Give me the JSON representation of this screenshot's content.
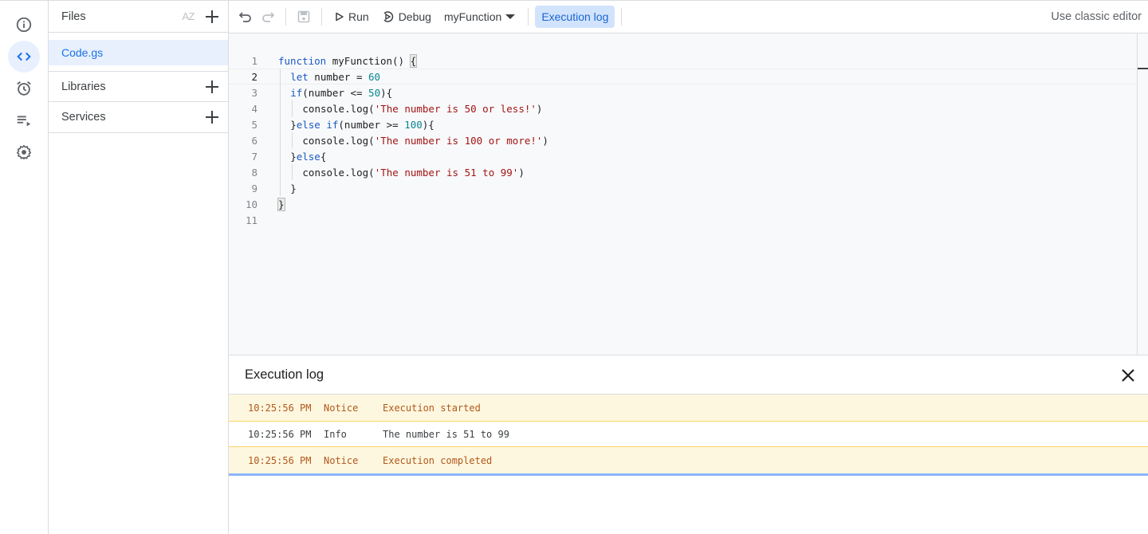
{
  "nav_rail": {
    "items": [
      {
        "name": "overview",
        "icon": "info-icon",
        "active": false
      },
      {
        "name": "editor",
        "icon": "code-icon",
        "active": true
      },
      {
        "name": "triggers",
        "icon": "alarm-clock-icon",
        "active": false
      },
      {
        "name": "executions",
        "icon": "playlist-play-icon",
        "active": false
      },
      {
        "name": "settings",
        "icon": "gear-icon",
        "active": false
      }
    ]
  },
  "files_panel": {
    "title": "Files",
    "sort_icon": "AZ",
    "files": [
      {
        "name": "Code.gs",
        "selected": true
      }
    ],
    "libraries_label": "Libraries",
    "services_label": "Services"
  },
  "toolbar": {
    "run_label": "Run",
    "debug_label": "Debug",
    "function_selector": "myFunction",
    "execution_log_label": "Execution log",
    "classic_editor_label": "Use classic editor"
  },
  "editor": {
    "current_line": 2,
    "lines": [
      {
        "n": "1",
        "indent": 0,
        "tokens": [
          [
            "kw",
            "function"
          ],
          [
            "p",
            " myFunction() "
          ],
          [
            "brk",
            "{"
          ]
        ]
      },
      {
        "n": "2",
        "indent": 1,
        "tokens": [
          [
            "kw",
            "let"
          ],
          [
            "p",
            " number = "
          ],
          [
            "num",
            "60"
          ]
        ]
      },
      {
        "n": "3",
        "indent": 1,
        "tokens": [
          [
            "kw",
            "if"
          ],
          [
            "p",
            "(number <= "
          ],
          [
            "num",
            "50"
          ],
          [
            "p",
            "){"
          ]
        ]
      },
      {
        "n": "4",
        "indent": 2,
        "tokens": [
          [
            "p",
            "console.log("
          ],
          [
            "str",
            "'The number is 50 or less!'"
          ],
          [
            "p",
            ")"
          ]
        ]
      },
      {
        "n": "5",
        "indent": 1,
        "tokens": [
          [
            "p",
            "}"
          ],
          [
            "kw",
            "else if"
          ],
          [
            "p",
            "(number >= "
          ],
          [
            "num",
            "100"
          ],
          [
            "p",
            "){"
          ]
        ]
      },
      {
        "n": "6",
        "indent": 2,
        "tokens": [
          [
            "p",
            "console.log("
          ],
          [
            "str",
            "'The number is 100 or more!'"
          ],
          [
            "p",
            ")"
          ]
        ]
      },
      {
        "n": "7",
        "indent": 1,
        "tokens": [
          [
            "p",
            "}"
          ],
          [
            "kw",
            "else"
          ],
          [
            "p",
            "{"
          ]
        ]
      },
      {
        "n": "8",
        "indent": 2,
        "tokens": [
          [
            "p",
            "console.log("
          ],
          [
            "str",
            "'The number is 51 to 99'"
          ],
          [
            "p",
            ")"
          ]
        ]
      },
      {
        "n": "9",
        "indent": 1,
        "tokens": [
          [
            "p",
            "}"
          ]
        ]
      },
      {
        "n": "10",
        "indent": 0,
        "tokens": [
          [
            "brk",
            "}"
          ]
        ]
      },
      {
        "n": "11",
        "indent": 0,
        "tokens": []
      }
    ]
  },
  "execution_log": {
    "title": "Execution log",
    "rows": [
      {
        "time": "10:25:56 PM",
        "level": "Notice",
        "message": "Execution started",
        "type": "notice"
      },
      {
        "time": "10:25:56 PM",
        "level": "Info",
        "message": "The number is 51 to 99",
        "type": "info"
      },
      {
        "time": "10:25:56 PM",
        "level": "Notice",
        "message": "Execution completed",
        "type": "notice"
      }
    ]
  }
}
